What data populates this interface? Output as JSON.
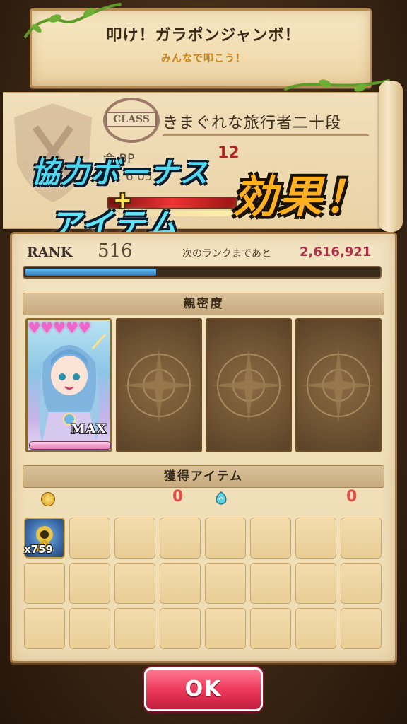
{
  "banner": {
    "title": "叩け！ガラポンジャンボ！",
    "subtitle": "みんなで叩こう！"
  },
  "class_card": {
    "stamp": "CLASS",
    "name": "きまぐれな旅行者二十段",
    "stat1_label": "会 BP",
    "stat1_value": "12",
    "stat2_label": "P 1 6 05"
  },
  "overlay": {
    "line1": "協力ボーナス",
    "plus": "+",
    "line2": "アイテム",
    "effect": "効果！"
  },
  "rank": {
    "label": "RANK",
    "value": "516",
    "next_label": "次のランクまであと",
    "next_value": "2,616,921",
    "progress": 0.37
  },
  "affinity": {
    "header": "親密度",
    "hearts": "♥♥♥♥♥",
    "max_label": "MAX"
  },
  "items": {
    "header": "獲得アイテム",
    "coin_count": "0",
    "gem_count": "0",
    "first_item_count": "x759"
  },
  "buttons": {
    "ok": "OK"
  },
  "colors": {
    "accent_red": "#e0504a",
    "xp_blue": "#2b74b8",
    "ok_pink": "#ef3a5c"
  }
}
